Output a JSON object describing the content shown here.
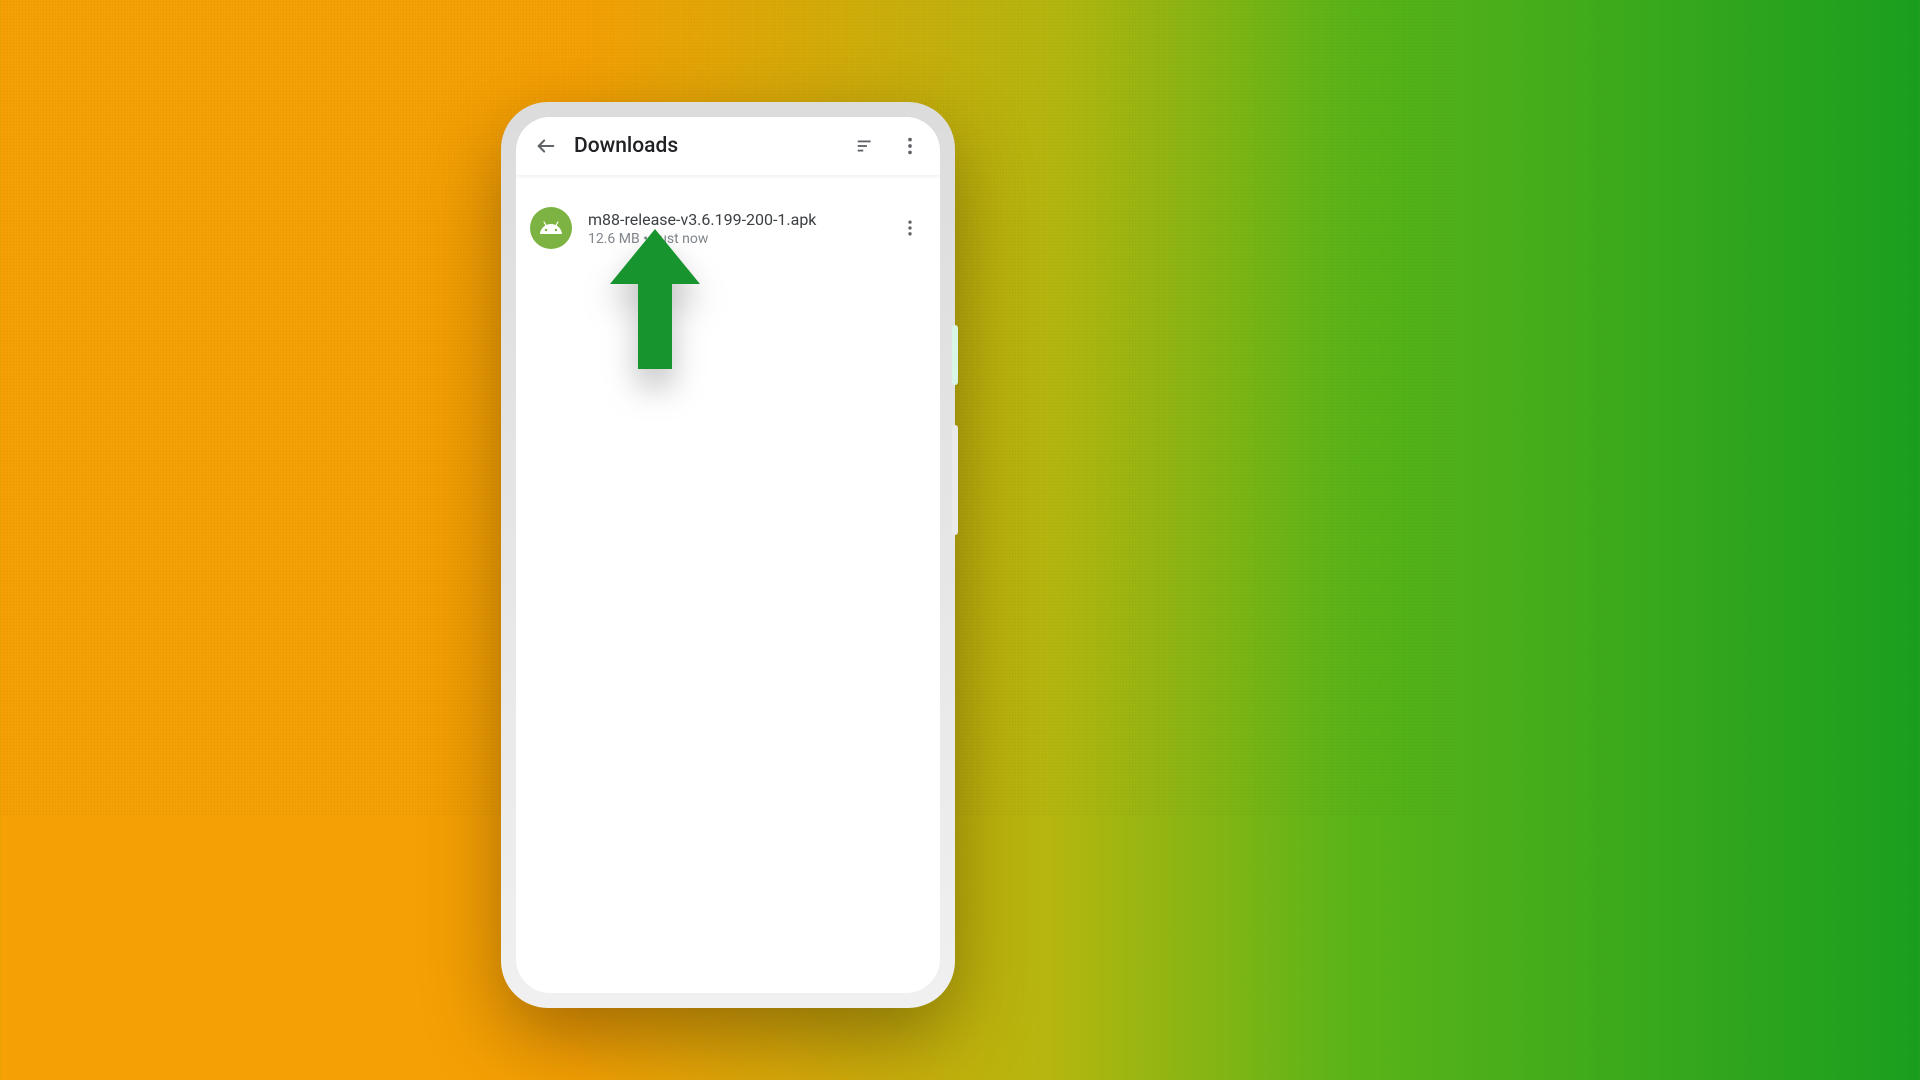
{
  "header": {
    "title": "Downloads"
  },
  "file": {
    "name": "m88-release-v3.6.199-200-1.apk",
    "size": "12.6 MB",
    "sep": "•",
    "time": "Just now"
  }
}
